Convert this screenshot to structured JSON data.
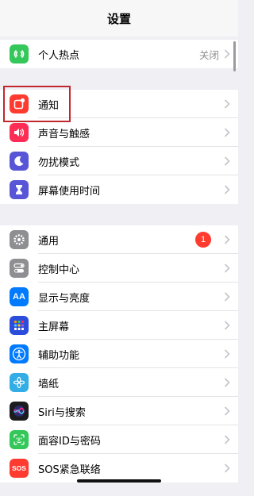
{
  "header": {
    "title": "设置"
  },
  "groups": {
    "top": [
      {
        "label": "个人热点",
        "value": "关闭",
        "icon": "hotspot-icon",
        "color": "#34c759"
      }
    ],
    "notifications": [
      {
        "label": "通知",
        "icon": "notifications-icon",
        "color": "#ff3b30"
      },
      {
        "label": "声音与触感",
        "icon": "sound-icon",
        "color": "#ff2d55"
      },
      {
        "label": "勿扰模式",
        "icon": "moon-icon",
        "color": "#5856d6"
      },
      {
        "label": "屏幕使用时间",
        "icon": "hourglass-icon",
        "color": "#5856d6"
      }
    ],
    "general": [
      {
        "label": "通用",
        "badge": "1",
        "icon": "gear-icon",
        "color": "#8e8e93"
      },
      {
        "label": "控制中心",
        "icon": "control-center-icon",
        "color": "#8e8e93"
      },
      {
        "label": "显示与亮度",
        "icon": "display-icon",
        "icon_text": "AA",
        "color": "#007aff"
      },
      {
        "label": "主屏幕",
        "icon": "home-screen-icon",
        "color": "#2c4ddb"
      },
      {
        "label": "辅助功能",
        "icon": "accessibility-icon",
        "color": "#007aff"
      },
      {
        "label": "墙纸",
        "icon": "wallpaper-icon",
        "color": "#32ade6"
      },
      {
        "label": "Siri与搜索",
        "icon": "siri-icon",
        "color": "#1c1c1e"
      },
      {
        "label": "面容ID与密码",
        "icon": "face-id-icon",
        "color": "#34c759"
      },
      {
        "label": "SOS紧急联络",
        "icon": "sos-icon",
        "icon_text": "SOS",
        "color": "#ff3b30"
      }
    ]
  }
}
